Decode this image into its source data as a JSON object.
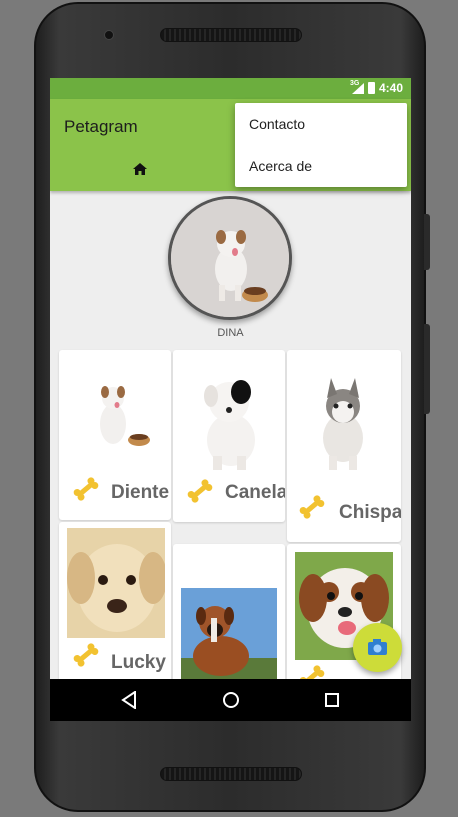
{
  "status_bar": {
    "network": "3G",
    "time": "4:40"
  },
  "app_bar": {
    "title": "Petagram",
    "home_icon": "home-icon"
  },
  "overflow_menu": {
    "items": [
      {
        "label": "Contacto"
      },
      {
        "label": "Acerca de"
      }
    ]
  },
  "profile": {
    "name": "DINA"
  },
  "pets": [
    {
      "name": "Diente",
      "icon": "bone-icon"
    },
    {
      "name": "Canela",
      "icon": "bone-icon"
    },
    {
      "name": "Chispa",
      "icon": "bone-icon"
    },
    {
      "name": "Lucky",
      "icon": "bone-icon"
    },
    {
      "name": "",
      "icon": ""
    },
    {
      "name": "",
      "icon": "bone-icon"
    }
  ],
  "fab": {
    "icon": "camera-icon"
  },
  "navigation": {
    "back": "back-icon",
    "home": "home-circle-icon",
    "recents": "recents-icon"
  },
  "colors": {
    "primary": "#8bc34a",
    "status": "#6cae3e",
    "accent": "#cddc39"
  }
}
